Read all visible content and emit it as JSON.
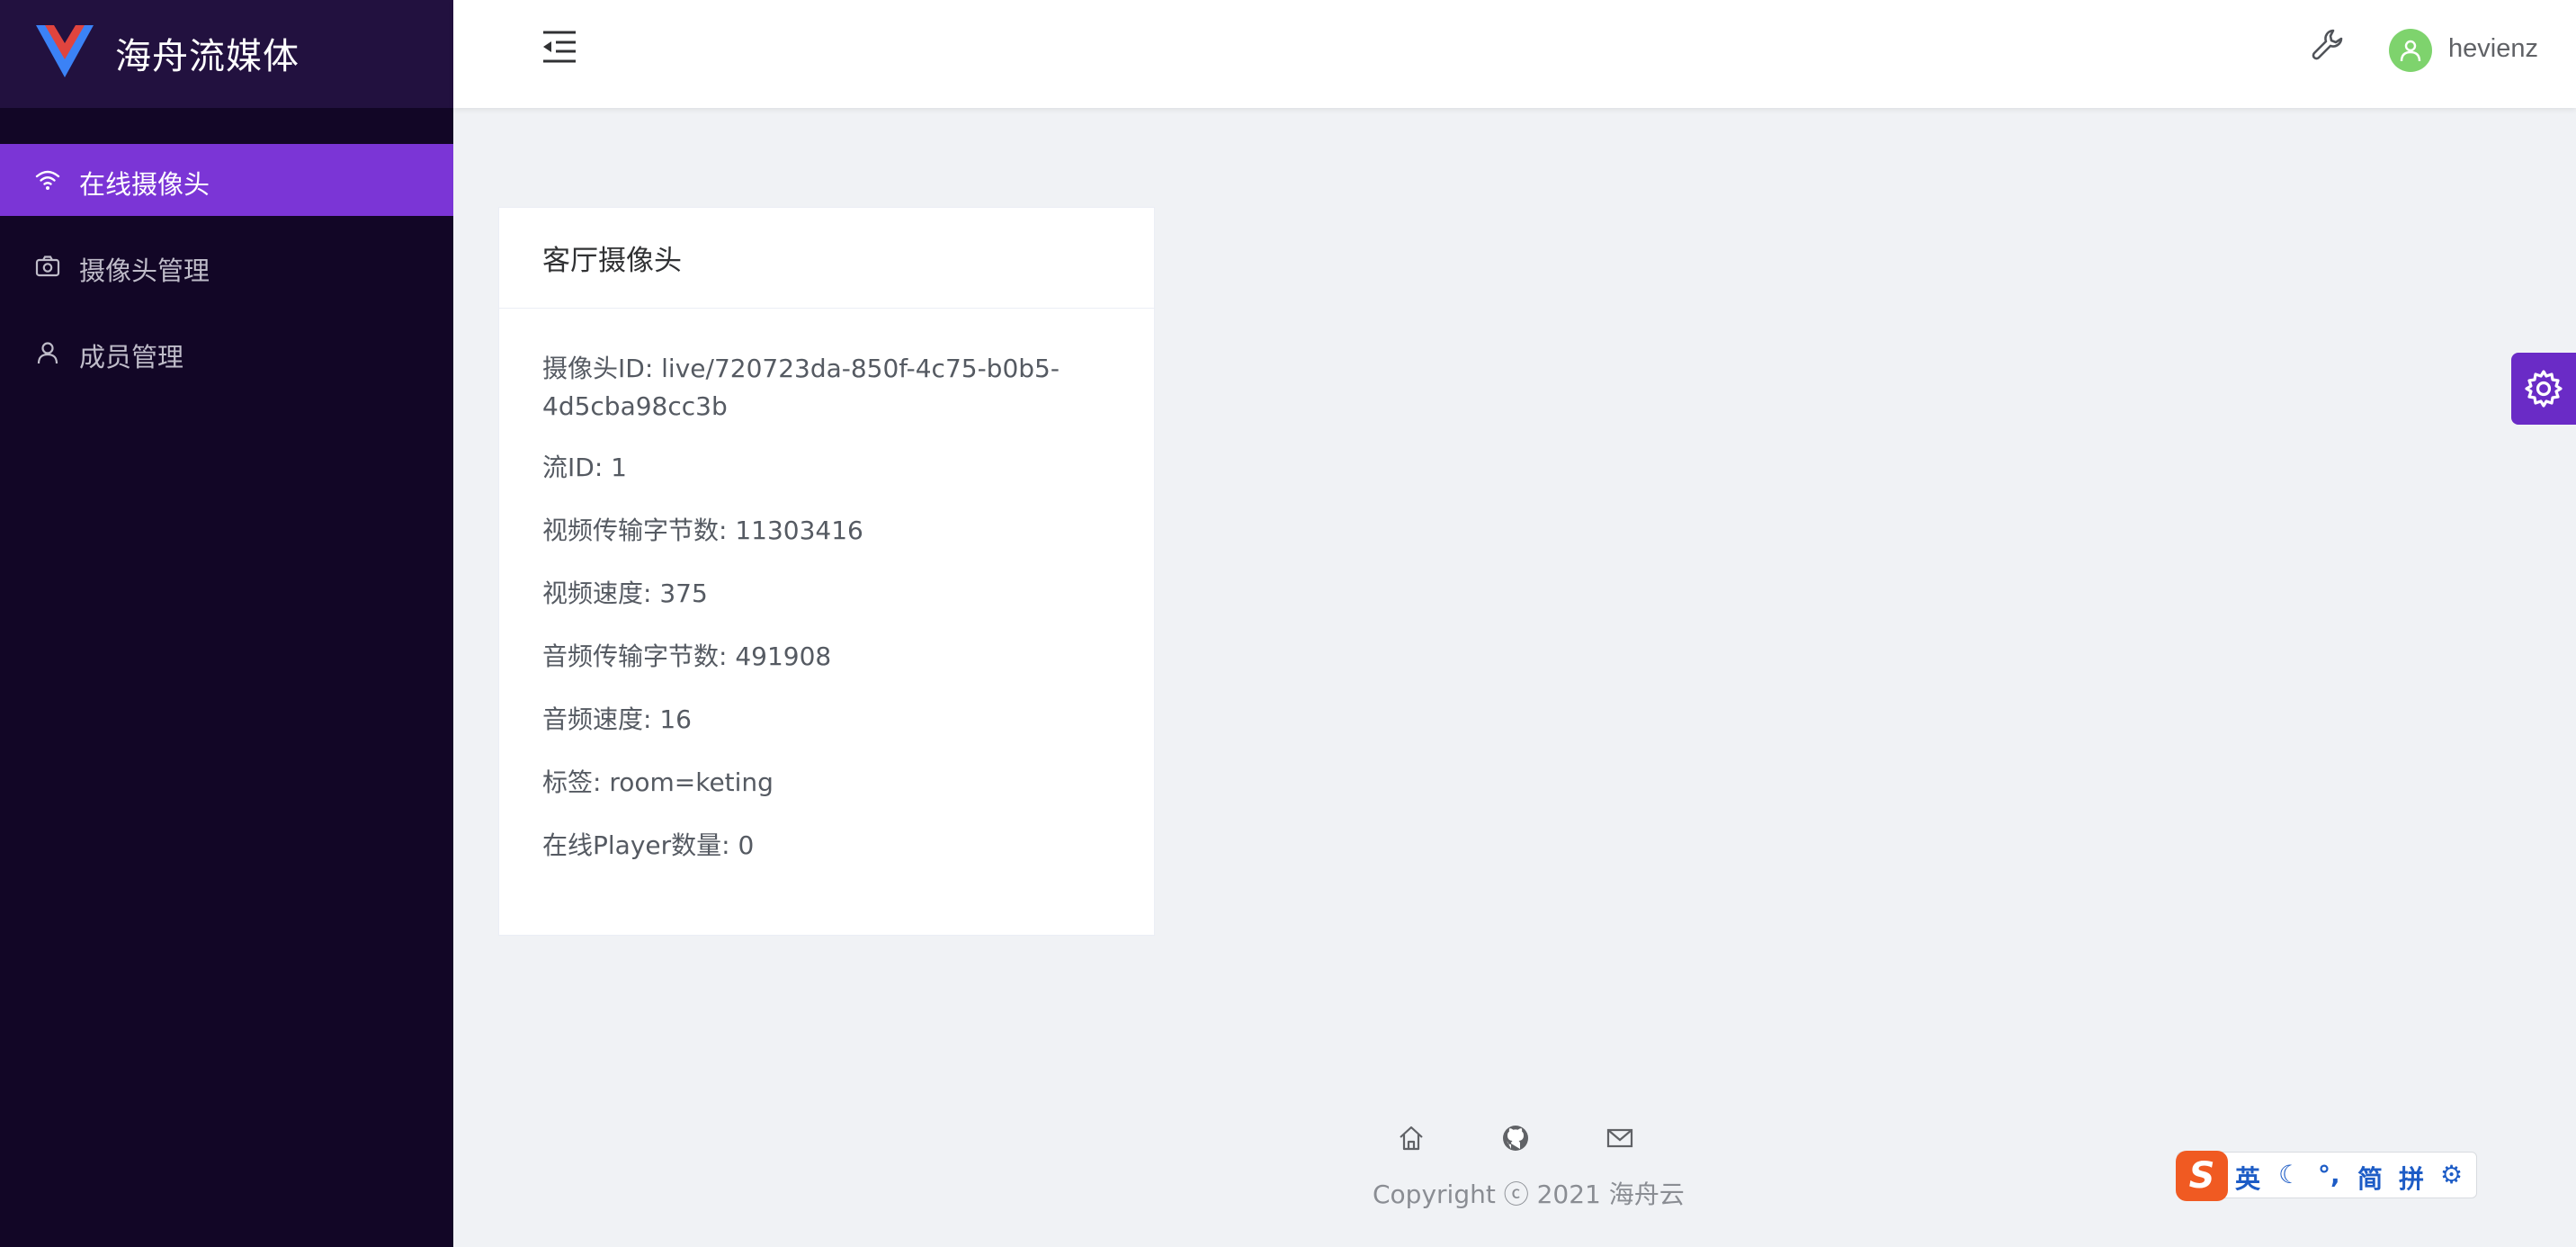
{
  "app": {
    "title": "海舟流媒体"
  },
  "sidebar": {
    "items": [
      {
        "label": "在线摄像头",
        "icon": "wifi-icon",
        "active": true
      },
      {
        "label": "摄像头管理",
        "icon": "camera-icon",
        "active": false
      },
      {
        "label": "成员管理",
        "icon": "user-icon",
        "active": false
      }
    ]
  },
  "header": {
    "username": "hevienz",
    "icons": [
      "menu-fold-icon",
      "wrench-icon",
      "user-avatar-icon"
    ]
  },
  "card": {
    "title": "客厅摄像头",
    "fields": [
      "摄像头ID: live/720723da-850f-4c75-b0b5-4d5cba98cc3b",
      "流ID: 1",
      "视频传输字节数: 11303416",
      "视频速度: 375",
      "音频传输字节数: 491908",
      "音频速度: 16",
      "标签: room=keting",
      "在线Player数量: 0"
    ]
  },
  "footer": {
    "links": [
      "home-icon",
      "github-icon",
      "mail-icon"
    ],
    "copyright": "Copyright ⓒ 2021 海舟云"
  },
  "ime": {
    "logo": "S",
    "items": [
      "英",
      "☾",
      "°,",
      "简",
      "拼",
      "⚙"
    ]
  },
  "colors": {
    "sidebar_bg": "#120626",
    "brand_bg": "#22113f",
    "accent": "#7b35d6",
    "settings_float": "#6a2bc6",
    "avatar": "#7ed36d"
  }
}
